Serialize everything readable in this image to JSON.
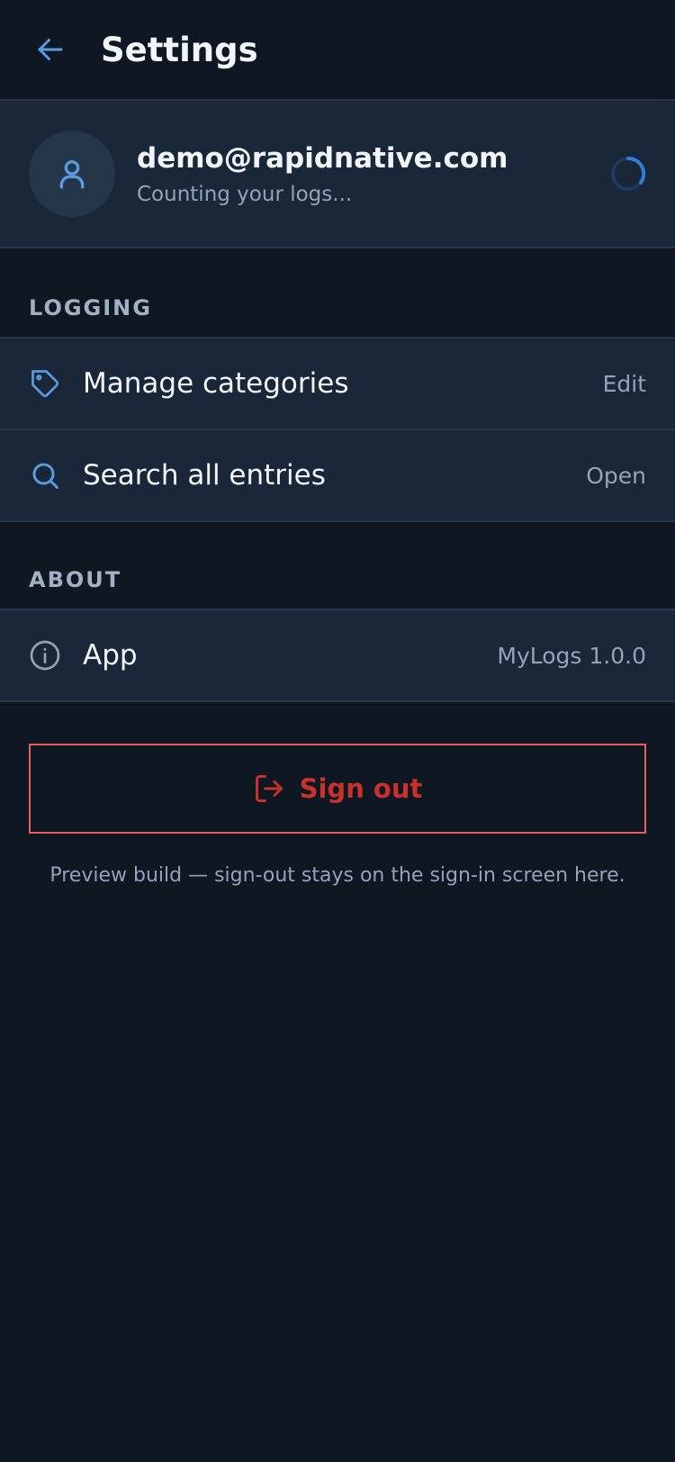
{
  "header": {
    "back_icon": "arrow-left-icon",
    "title": "Settings"
  },
  "account": {
    "avatar_icon": "user-icon",
    "email": "demo@rapidnative.com",
    "status": "Counting your logs..."
  },
  "sections": {
    "logging": {
      "label": "LOGGING",
      "items": [
        {
          "icon": "tag-icon",
          "label": "Manage categories",
          "value": "Edit"
        },
        {
          "icon": "search-icon",
          "label": "Search all entries",
          "value": "Open"
        }
      ]
    },
    "about": {
      "label": "ABOUT",
      "items": [
        {
          "icon": "info-icon",
          "label": "App",
          "value": "MyLogs 1.0.0"
        }
      ]
    }
  },
  "signout": {
    "icon": "log-out-icon",
    "label": "Sign out",
    "note": "Preview build — sign-out stays on the sign-in screen here."
  },
  "colors": {
    "background": "#0f1723",
    "card": "#1a2738",
    "accent": "#5b9be0",
    "danger": "#c8322b",
    "muted": "#94a3b8"
  }
}
